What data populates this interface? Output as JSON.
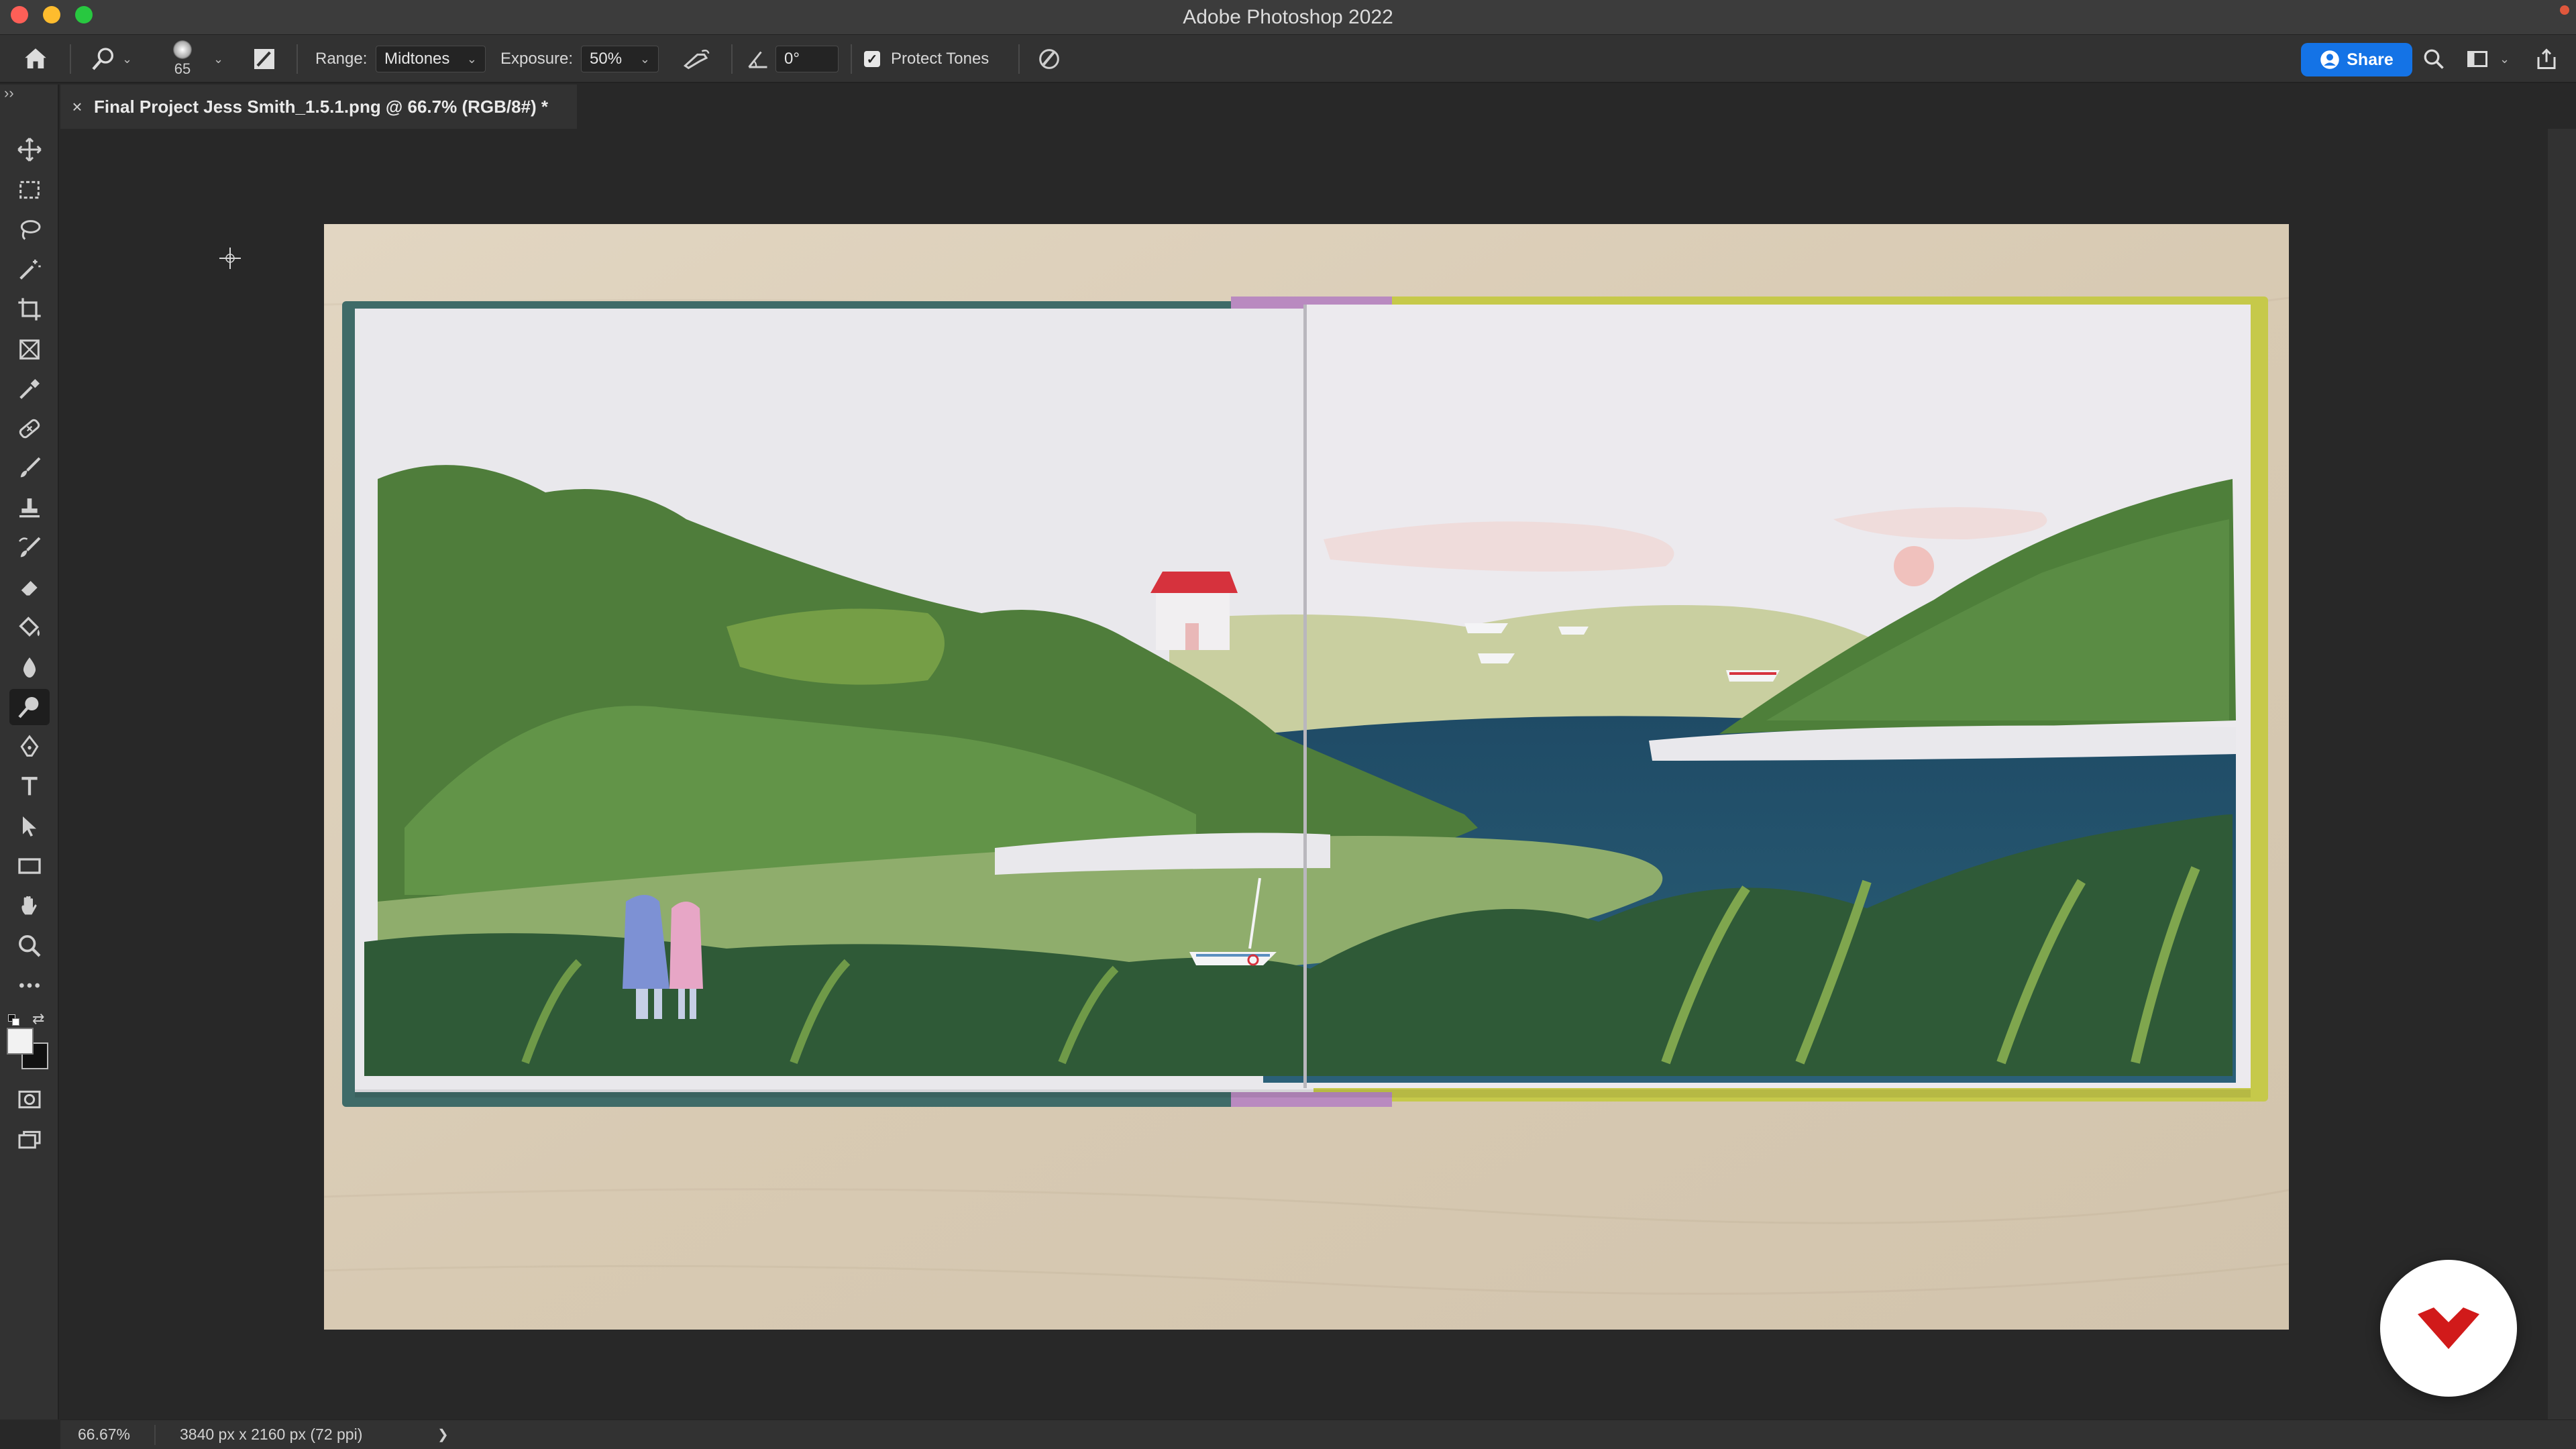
{
  "window": {
    "title": "Adobe Photoshop 2022"
  },
  "options_bar": {
    "brush_size": "65",
    "range_label": "Range:",
    "range_value": "Midtones",
    "exposure_label": "Exposure:",
    "exposure_value": "50%",
    "angle_value": "0°",
    "protect_tones_label": "Protect Tones",
    "protect_tones_checked": true,
    "share_label": "Share"
  },
  "document_tab": {
    "close_glyph": "×",
    "title": "Final Project Jess Smith_1.5.1.png @ 66.7% (RGB/8#) *"
  },
  "toolbar": {
    "tools": [
      {
        "name": "move-tool-icon"
      },
      {
        "name": "marquee-tool-icon"
      },
      {
        "name": "lasso-tool-icon"
      },
      {
        "name": "magic-wand-tool-icon"
      },
      {
        "name": "crop-tool-icon"
      },
      {
        "name": "frame-tool-icon"
      },
      {
        "name": "eyedropper-tool-icon"
      },
      {
        "name": "healing-brush-tool-icon"
      },
      {
        "name": "brush-tool-icon"
      },
      {
        "name": "clone-stamp-tool-icon"
      },
      {
        "name": "history-brush-tool-icon"
      },
      {
        "name": "eraser-tool-icon"
      },
      {
        "name": "paint-bucket-tool-icon"
      },
      {
        "name": "blur-tool-icon"
      },
      {
        "name": "dodge-tool-icon",
        "active": true
      },
      {
        "name": "pen-tool-icon"
      },
      {
        "name": "type-tool-icon"
      },
      {
        "name": "path-selection-tool-icon"
      },
      {
        "name": "rectangle-tool-icon"
      },
      {
        "name": "hand-tool-icon"
      },
      {
        "name": "zoom-tool-icon"
      },
      {
        "name": "more-tools-icon"
      }
    ],
    "foreground_color": "#f2f2f2",
    "background_color": "#111111"
  },
  "status_bar": {
    "zoom": "66.67%",
    "doc_info": "3840 px x 2160 px (72 ppi)",
    "arrow": "❯"
  },
  "colors": {
    "accent": "#1473e6",
    "ui_dark": "#282828",
    "panel": "#323232"
  }
}
